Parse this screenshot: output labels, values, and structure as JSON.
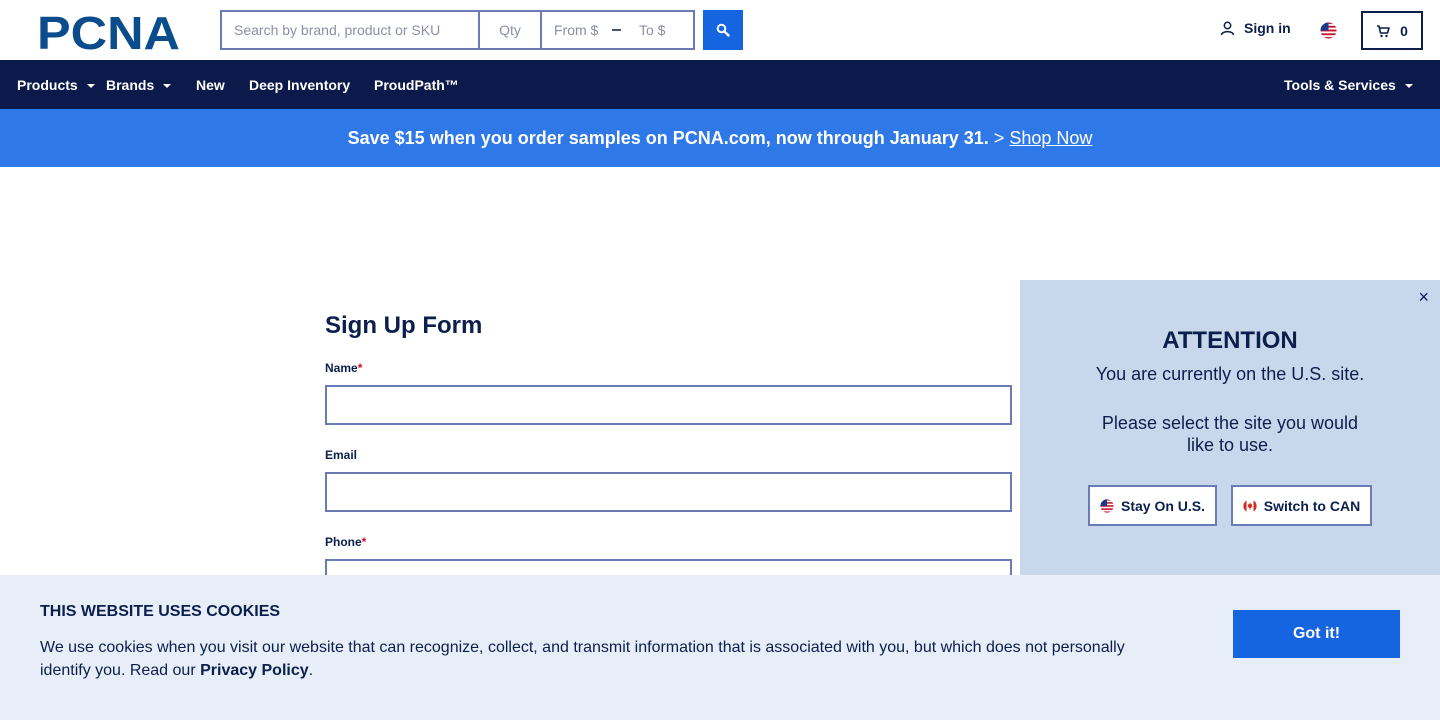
{
  "header": {
    "logo_text": "PCNA",
    "search_placeholder": "Search by brand, product or SKU",
    "qty_placeholder": "Qty",
    "price_from_placeholder": "From $",
    "price_to_placeholder": "To $",
    "signin_label": "Sign in",
    "cart_count": "0"
  },
  "nav": {
    "items": [
      {
        "label": "Products",
        "dropdown": true
      },
      {
        "label": "Brands",
        "dropdown": true
      },
      {
        "label": "New",
        "dropdown": false
      },
      {
        "label": "Deep Inventory",
        "dropdown": false
      },
      {
        "label": "ProudPath™",
        "dropdown": false
      }
    ],
    "tools_label": "Tools & Services"
  },
  "promo": {
    "message": "Save $15 when you order samples on PCNA.com, now through January 31.",
    "arrow": ">",
    "link_label": "Shop Now"
  },
  "form": {
    "title": "Sign Up Form",
    "fields": [
      {
        "label": "Name",
        "required": "*"
      },
      {
        "label": "Email",
        "required": ""
      },
      {
        "label": "Phone",
        "required": "*"
      }
    ]
  },
  "attention": {
    "close": "×",
    "title": "ATTENTION",
    "line1": "You are currently on the U.S. site.",
    "line2": "Please select the site you would like to use.",
    "stay_label": "Stay On U.S.",
    "switch_label": "Switch to CAN"
  },
  "cookie": {
    "title": "THIS WEBSITE USES COOKIES",
    "text": "We use cookies when you visit our website that can recognize, collect, and transmit information that is associated with you, but which does not personally identify you. Read our",
    "link_label": "Privacy Policy",
    "period": ".",
    "button_label": "Got it!"
  },
  "colors": {
    "navy": "#0b1a4a",
    "brand_blue": "#1565e0",
    "promo_blue": "#2f78e8",
    "panel_bg": "#c9d7ec",
    "cookie_bg": "#e8eef8"
  }
}
